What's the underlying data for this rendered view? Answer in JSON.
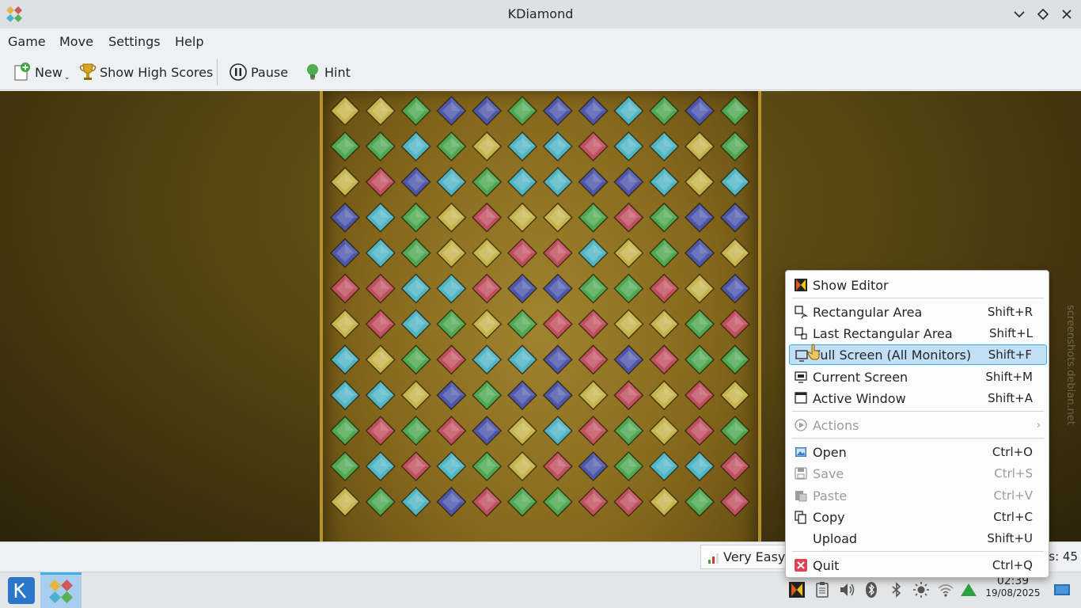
{
  "window": {
    "title": "KDiamond"
  },
  "menubar": {
    "items": [
      "Game",
      "Move",
      "Settings",
      "Help"
    ]
  },
  "toolbar": {
    "new_label": "New",
    "high_scores_label": "Show High Scores",
    "pause_label": "Pause",
    "hint_label": "Hint"
  },
  "colors": {
    "yellow": "#c6b44c",
    "green": "#4ea852",
    "blue": "#4e57ab",
    "cyan": "#50b5c5",
    "red": "#c05060",
    "menu_highlight": "#c2e0f5",
    "accent": "#3daee9"
  },
  "board": {
    "rows": [
      "YYGBBGBBCGBG",
      "GGCGYCCRCCYG",
      "YRBCGCCBBCYC",
      "BCGYRYYGRGBB",
      "BCGYYRRCYGBY",
      "RRCCRBBGGRYB",
      "YRCGYGRRYYGR",
      "CYGRCCBRBRGG",
      "CCYBGBBYRYRY",
      "GRGRBYCRGYRG",
      "GCRCGYRBGCCR",
      "YGCBRGGRRYGR"
    ]
  },
  "status": {
    "difficulty": "Very Easy",
    "moves_text": "es: 45"
  },
  "context_menu": {
    "items": [
      {
        "label": "Show Editor",
        "shortcut": ""
      },
      {
        "label": "Rectangular Area",
        "shortcut": "Shift+R"
      },
      {
        "label": "Last Rectangular Area",
        "shortcut": "Shift+L"
      },
      {
        "label": "Full Screen (All Monitors)",
        "shortcut": "Shift+F"
      },
      {
        "label": "Current Screen",
        "shortcut": "Shift+M"
      },
      {
        "label": "Active Window",
        "shortcut": "Shift+A"
      },
      {
        "label": "Actions",
        "shortcut": ""
      },
      {
        "label": "Open",
        "shortcut": "Ctrl+O"
      },
      {
        "label": "Save",
        "shortcut": "Ctrl+S"
      },
      {
        "label": "Paste",
        "shortcut": "Ctrl+V"
      },
      {
        "label": "Copy",
        "shortcut": "Ctrl+C"
      },
      {
        "label": "Upload",
        "shortcut": "Shift+U"
      },
      {
        "label": "Quit",
        "shortcut": "Ctrl+Q"
      }
    ]
  },
  "taskbar": {
    "clock_time": "02:39",
    "clock_date": "19/08/2025"
  },
  "watermark": "screenshots.debian.net"
}
